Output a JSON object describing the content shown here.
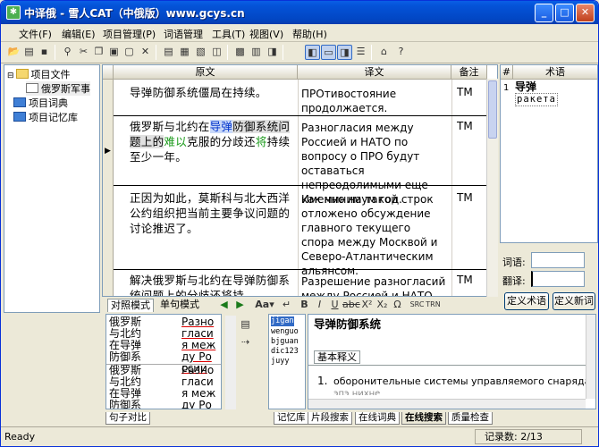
{
  "window": {
    "title": "中译俄 - 雪人CAT（中俄版）www.gcys.cn",
    "min": "_",
    "max": "□",
    "close": "✕"
  },
  "menu": [
    "文件(F)",
    "编辑(E)",
    "项目管理(P)",
    "词语管理",
    "工具(T)",
    "视图(V)",
    "帮助(H)"
  ],
  "tree": {
    "project_files": "项目文件",
    "file": "俄罗斯军事",
    "dictionary": "项目词典",
    "memory": "项目记忆库"
  },
  "grid": {
    "headers": {
      "source": "原文",
      "target": "译文",
      "note": "备注"
    },
    "rows": [
      {
        "src": "导弹防御系统僵局在持续。",
        "tgt": "ПРОтивостояние продолжается.",
        "note": "TM"
      },
      {
        "src1": "俄罗斯与北约在",
        "src_hl1": "导弹",
        "src2": "防御系统问题上的",
        "src_hl2": "难以",
        "src3": "克服的分歧还",
        "src_hl3": "将",
        "src4": "持续至少一年。",
        "tgt": "Разногласия между Россией и НАТО по вопросу о ПРО будут оставаться непреодолимыми еще как минимум год.",
        "note": "TM",
        "indicator": "▶"
      },
      {
        "src": "正因为如此，莫斯科与北大西洋公约组织把当前主要争议问题的讨论推迟了。",
        "tgt": "Именно на такой строк отложено обсуждение главного текущего спора между Москвой и Северо-Атлантическим альянсом.",
        "note": "TM"
      },
      {
        "src": "解决俄罗斯与北约在导弹防御系统问题上的分歧还将持",
        "tgt": "Разрешение разногласий между Россией и НАТО по",
        "note": "TM"
      }
    ]
  },
  "terms": {
    "col_num": "#",
    "col_term": "术语",
    "num": "1",
    "zh": "导弹",
    "ru": "ракета"
  },
  "term_form": {
    "word_label": "词语:",
    "trans_label": "翻译:",
    "define_term": "定义术语",
    "define_word": "定义新词"
  },
  "mode_tabs": {
    "compare": "对照模式",
    "single": "单句模式"
  },
  "bottom": {
    "left_zh": "俄罗斯与北约在导弹防御系",
    "left_ru": "Разногласия между России",
    "left_zh2": "俄罗斯与北约在导弹防御系",
    "left_ru2": "Разногласия между России",
    "dict_list": [
      "jigan",
      "wenguo",
      "bjguan",
      "dic123",
      "juyy"
    ],
    "dict_title": "导弹防御系统",
    "dict_tab": "基本释义",
    "dict_def_num": "1.",
    "dict_def": "оборонительные системы управляемого снаряда",
    "dict_def2": "эпэ нихне"
  },
  "bottom_tabs": {
    "left": "句子对比",
    "tabs": [
      "记忆库",
      "片段搜索",
      "在线词典",
      "在线搜索",
      "质量检查"
    ]
  },
  "status": {
    "left": "Ready",
    "right": "记录数: 2/13"
  }
}
